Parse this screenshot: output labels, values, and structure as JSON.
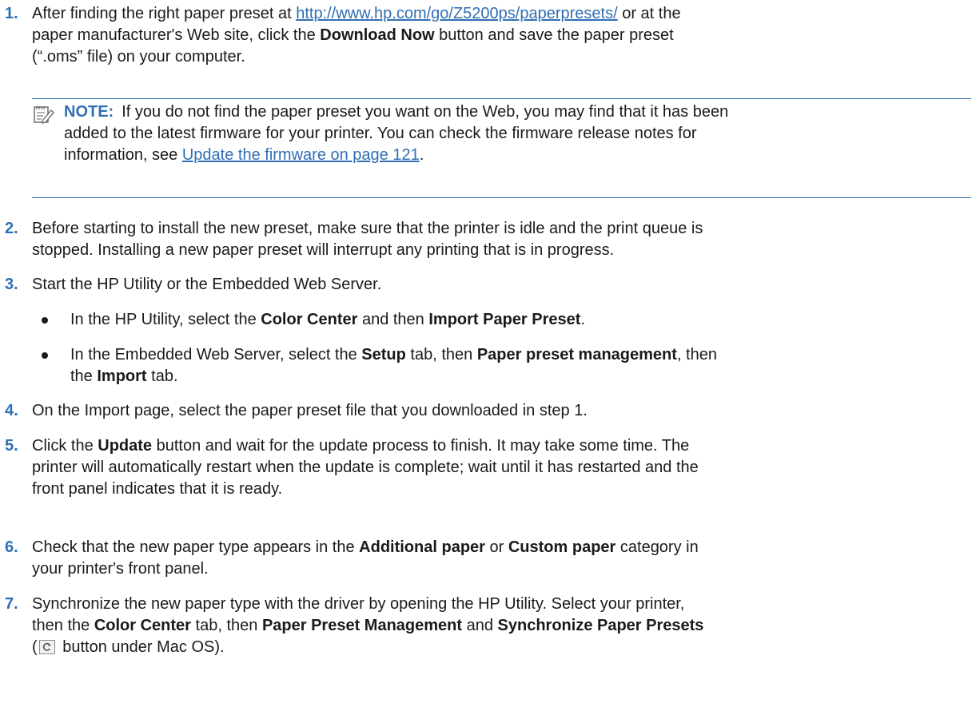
{
  "steps": {
    "s1": {
      "number": "1.",
      "l1_a": "After finding the right paper preset at ",
      "l1_link": "http://www.hp.com/go/Z5200ps/paperpresets/",
      "l1_b": " or at the",
      "l2_a": "paper manufacturer's Web site, click the ",
      "l2_bold": "Download Now",
      "l2_b": " button and save the paper preset",
      "l3": "(“.oms” file) on your computer."
    },
    "note": {
      "label": "NOTE:",
      "l1": "If you do not find the paper preset you want on the Web, you may find that it has been",
      "l2": "added to the latest firmware for your printer. You can check the firmware release notes for",
      "l3_a": "information, see ",
      "l3_link": "Update the firmware on page 121",
      "l3_b": "."
    },
    "s2": {
      "number": "2.",
      "l1": "Before starting to install the new preset, make sure that the printer is idle and the print queue is",
      "l2": "stopped. Installing a new paper preset will interrupt any printing that is in progress."
    },
    "s3": {
      "number": "3.",
      "l1": "Start the HP Utility or the Embedded Web Server."
    },
    "b1": {
      "a": "In the HP Utility, select the ",
      "bold1": "Color Center",
      "b": " and then ",
      "bold2": "Import Paper Preset",
      "c": "."
    },
    "b2": {
      "a": "In the Embedded Web Server, select the ",
      "bold1": "Setup",
      "b": " tab, then ",
      "bold2": "Paper preset management",
      "c": ", then",
      "l2_a": "the ",
      "l2_bold": "Import",
      "l2_b": " tab."
    },
    "s4": {
      "number": "4.",
      "l1": "On the Import page, select the paper preset file that you downloaded in step 1."
    },
    "s5": {
      "number": "5.",
      "l1_a": "Click the ",
      "l1_bold": "Update",
      "l1_b": " button and wait for the update process to finish. It may take some time. The",
      "l2": "printer will automatically restart when the update is complete; wait until it has restarted and the",
      "l3": "front panel indicates that it is ready."
    },
    "s6": {
      "number": "6.",
      "l1_a": "Check that the new paper type appears in the ",
      "l1_bold1": "Additional paper",
      "l1_b": " or ",
      "l1_bold2": "Custom paper",
      "l1_c": " category in",
      "l2": "your printer's front panel."
    },
    "s7": {
      "number": "7.",
      "l1": "Synchronize the new paper type with the driver by opening the HP Utility. Select your printer,",
      "l2_a": "then the ",
      "l2_bold1": "Color Center",
      "l2_b": " tab, then ",
      "l2_bold2": "Paper Preset Management",
      "l2_c": " and ",
      "l2_bold3": "Synchronize Paper Presets",
      "l3_a": "(",
      "l3_b": " button under Mac OS)."
    }
  },
  "icons": {
    "note": "note-pad-icon",
    "sync": "synchronize-button-icon"
  },
  "colors": {
    "accent": "#2f6fb5",
    "text": "#1a1a1a"
  }
}
